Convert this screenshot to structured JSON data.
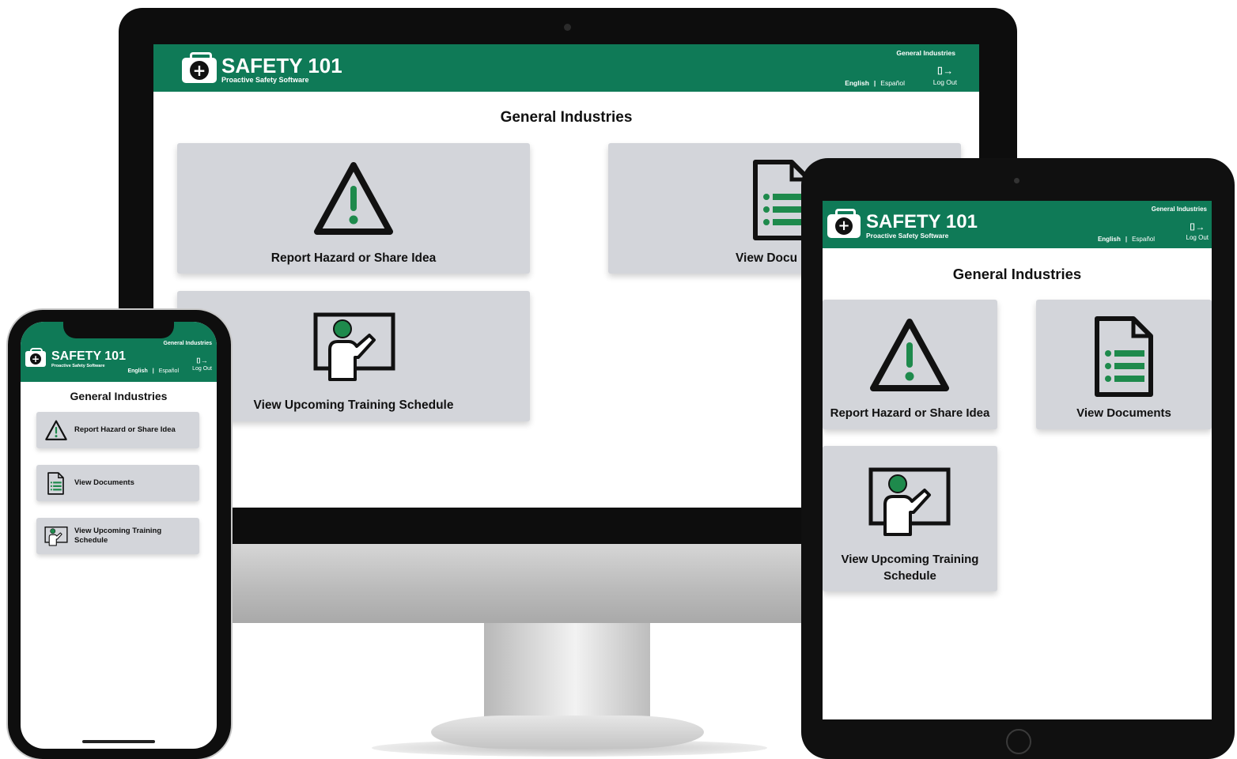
{
  "brand": {
    "name": "SAFETY 101",
    "tagline": "Proactive Safety Software"
  },
  "header": {
    "industry": "General Industries",
    "lang_english": "English",
    "lang_separator": "|",
    "lang_spanish": "Español",
    "logout_label": "Log Out"
  },
  "page": {
    "title": "General Industries"
  },
  "tiles": {
    "report_hazard": "Report Hazard or Share Idea",
    "view_documents": "View Documents",
    "view_documents_cropped": "View Docu",
    "training_schedule": "View Upcoming Training Schedule"
  },
  "colors": {
    "brand_green": "#0f7a57",
    "tile_gray": "#d3d5da",
    "icon_green": "#1e8a4c"
  },
  "icons": [
    "first-aid-kit-icon",
    "logout-door-icon",
    "warning-triangle-icon",
    "document-list-icon",
    "trainer-whiteboard-icon"
  ]
}
